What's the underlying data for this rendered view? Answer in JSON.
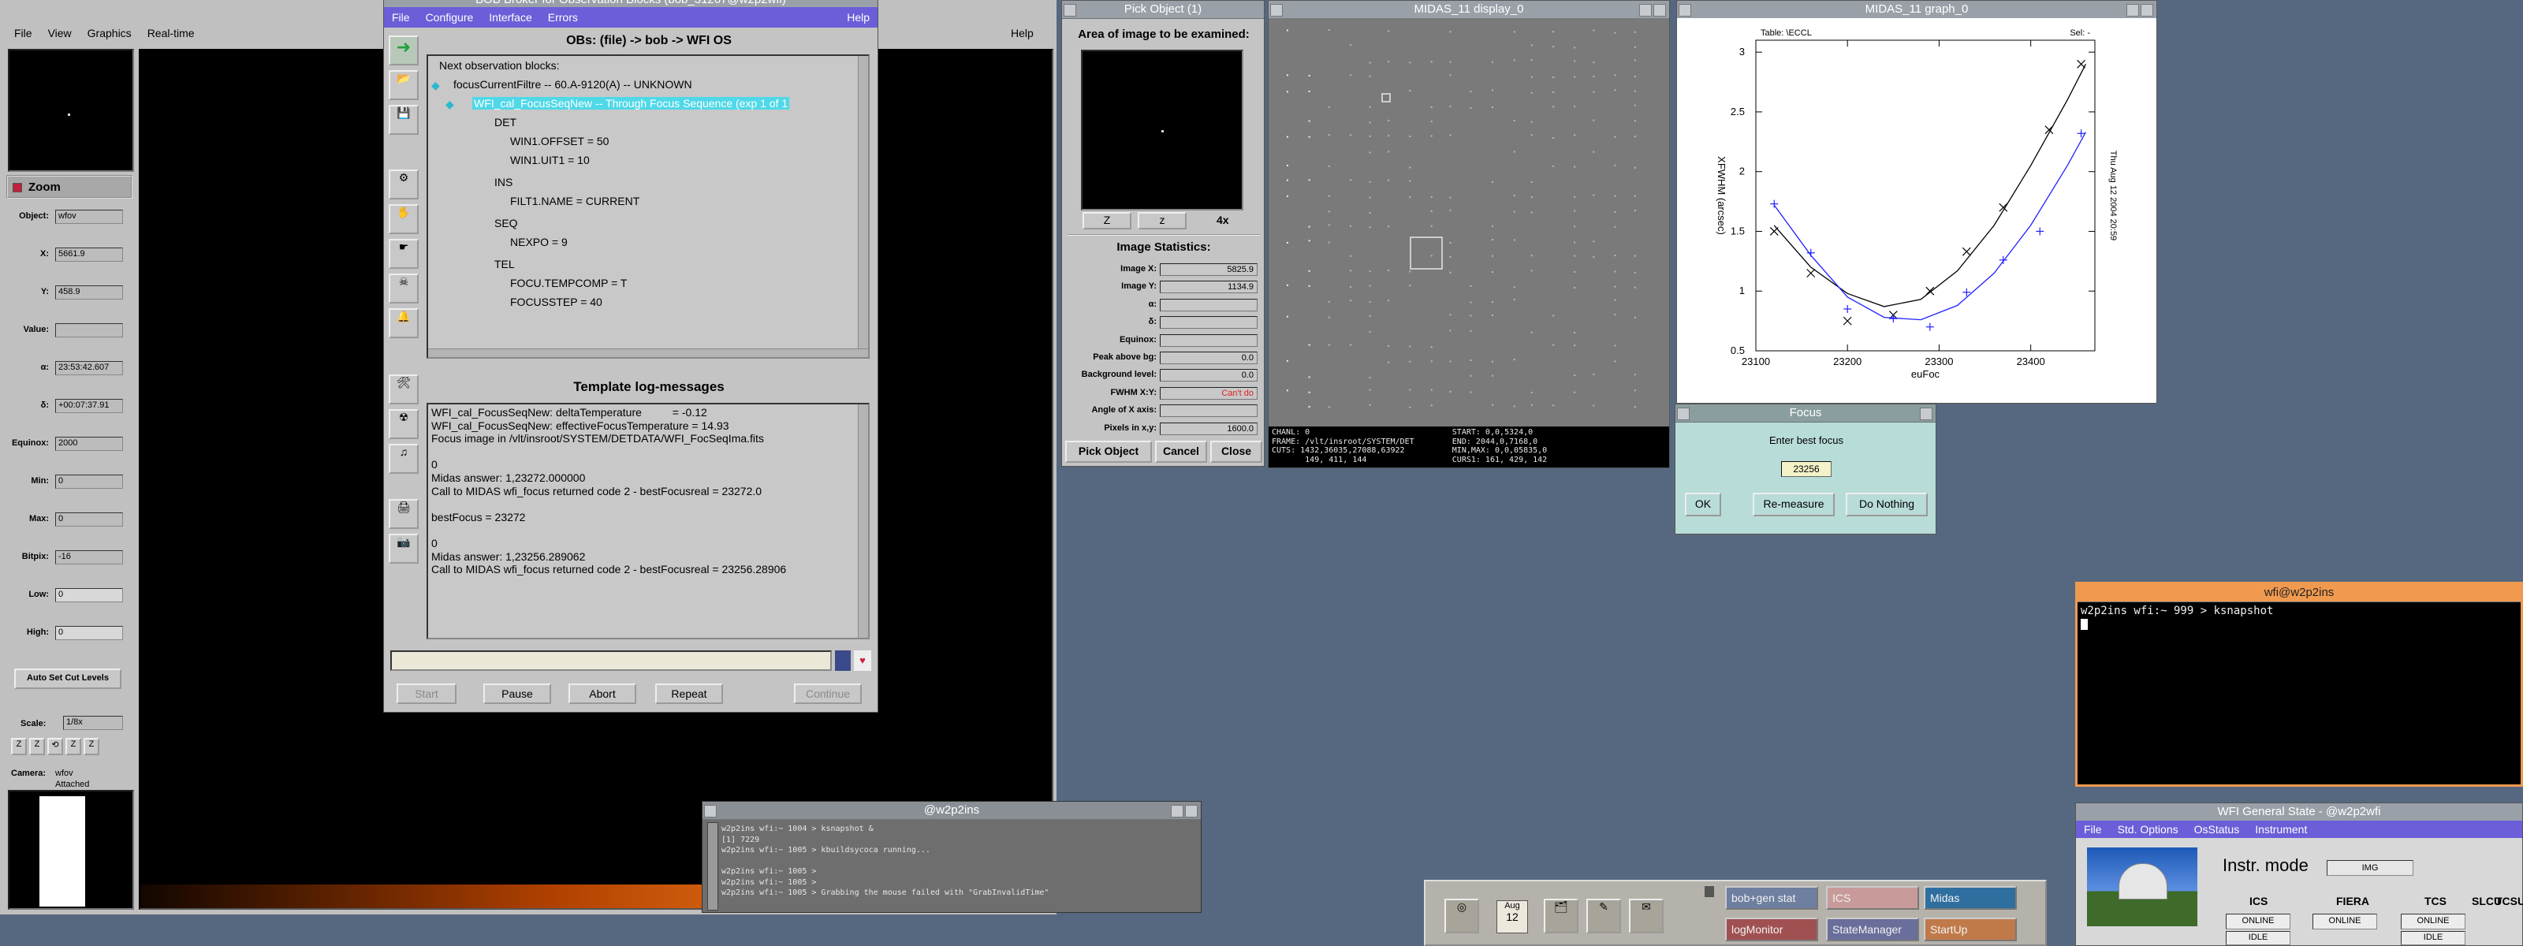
{
  "rtd": {
    "menu": [
      "File",
      "View",
      "Graphics",
      "Real-time"
    ],
    "zoom_label": "Zoom",
    "fields": [
      {
        "label": "Object:",
        "value": "wfov"
      },
      {
        "label": "X:",
        "value": "5661.9"
      },
      {
        "label": "Y:",
        "value": "458.9"
      },
      {
        "label": "Value:",
        "value": ""
      },
      {
        "label": "α:",
        "value": "23:53:42.607"
      },
      {
        "label": "δ:",
        "value": "+00:07:37.91"
      },
      {
        "label": "Equinox:",
        "value": "2000"
      },
      {
        "label": "Min:",
        "value": "0"
      },
      {
        "label": "Max:",
        "value": "0"
      },
      {
        "label": "Bitpix:",
        "value": "-16"
      },
      {
        "label": "Low:",
        "value": "0"
      },
      {
        "label": "High:",
        "value": "0"
      }
    ],
    "autocut_label": "Auto Set Cut Levels",
    "scale_label": "Scale:",
    "scale_value": "1/8x",
    "camera_label": "Camera:",
    "camera_value": "wfov",
    "camera_status": "Attached",
    "help": "Help"
  },
  "bob": {
    "title": "BOB Broker for Observation Blocks (bob_31267@w2p2wfi)",
    "menu": [
      "File",
      "Configure",
      "Interface",
      "Errors"
    ],
    "help": "Help",
    "ob_title": "OBs: (file) -> bob -> WFI OS",
    "tree": [
      {
        "text": "Next observation blocks:",
        "indent": 0,
        "selected": false
      },
      {
        "text": "focusCurrentFiltre --  60.A-9120(A) -- UNKNOWN",
        "indent": 1,
        "selected": false
      },
      {
        "text": "WFI_cal_FocusSeqNew -- Through Focus Sequence (exp 1 of 1",
        "indent": 2,
        "selected": true
      },
      {
        "text": "DET",
        "indent": 3,
        "selected": false
      },
      {
        "text": "WIN1.OFFSET = 50",
        "indent": 4,
        "selected": false
      },
      {
        "text": "WIN1.UIT1 = 10",
        "indent": 4,
        "selected": false
      },
      {
        "text": "INS",
        "indent": 3,
        "selected": false
      },
      {
        "text": "FILT1.NAME = CURRENT",
        "indent": 4,
        "selected": false
      },
      {
        "text": "SEQ",
        "indent": 3,
        "selected": false
      },
      {
        "text": "NEXPO = 9",
        "indent": 4,
        "selected": false
      },
      {
        "text": "TEL",
        "indent": 3,
        "selected": false
      },
      {
        "text": "FOCU.TEMPCOMP = T",
        "indent": 4,
        "selected": false
      },
      {
        "text": "FOCUSSTEP = 40",
        "indent": 4,
        "selected": false
      }
    ],
    "log_title": "Template log-messages",
    "log": [
      "WFI_cal_FocusSeqNew: deltaTemperature          = -0.12",
      "WFI_cal_FocusSeqNew: effectiveFocusTemperature = 14.93",
      "Focus image in /vlt/insroot/SYSTEM/DETDATA/WFI_FocSeqIma.fits",
      "",
      "0",
      "Midas answer: 1,23272.000000",
      "Call to MIDAS wfi_focus returned code 2 - bestFocusreal = 23272.0",
      "",
      "bestFocus = 23272",
      "",
      "0",
      "Midas answer: 1,23256.289062",
      "Call to MIDAS wfi_focus returned code 2 - bestFocusreal = 23256.28906"
    ],
    "buttons": [
      "Start",
      "Pause",
      "Abort",
      "Repeat",
      "Continue"
    ]
  },
  "pick": {
    "title": "Pick Object (1)",
    "area_label": "Area of image to be examined:",
    "zoom_buttons": [
      "Z",
      "z",
      "4x"
    ],
    "stats_title": "Image Statistics:",
    "rows": [
      {
        "label": "Image X:",
        "value": "5825.9"
      },
      {
        "label": "Image Y:",
        "value": "1134.9"
      },
      {
        "label": "α:",
        "value": ""
      },
      {
        "label": "δ:",
        "value": ""
      },
      {
        "label": "Equinox:",
        "value": ""
      },
      {
        "label": "Peak above bg:",
        "value": "0.0"
      },
      {
        "label": "Background level:",
        "value": "0.0"
      },
      {
        "label": "FWHM X:Y:",
        "value": "Can't do"
      },
      {
        "label": "Angle of X axis:",
        "value": ""
      },
      {
        "label": "Pixels in x,y:",
        "value": "1600.0"
      }
    ],
    "buttons": [
      "Pick Object",
      "Cancel",
      "Close"
    ]
  },
  "midas_display": {
    "title": "MIDAS_11 display_0",
    "info_lines": [
      "CHANL: 0                              START: 0,0,5324,0",
      "FRAME: /vlt/insroot/SYSTEM/DET        END: 2044,0,7168,0",
      "CUTS: 1432,36035,27088,63922          MIN,MAX: 0,0,05835,0",
      "       149, 411, 144                  CURS1: 161, 429, 142"
    ]
  },
  "graph": {
    "title": "MIDAS_11 graph_0",
    "corner_left": "Table: \\ECCL",
    "corner_right": "Sel: -",
    "side_text": "Thu Aug 12 2004 20:59",
    "chart_data": {
      "type": "scatter",
      "xlabel": "euFoc",
      "ylabel": "XFWHM (arcsec)",
      "xlim": [
        23100,
        23470
      ],
      "ylim": [
        0.5,
        3.1
      ],
      "xticks": [
        23100,
        23200,
        23300,
        23400
      ],
      "yticks": [
        0.5,
        1,
        1.5,
        2,
        2.5,
        3
      ],
      "series": [
        {
          "marker": "x",
          "color": "#000000",
          "x": [
            23120,
            23160,
            23200,
            23250,
            23290,
            23330,
            23370,
            23420,
            23455
          ],
          "y": [
            1.5,
            1.15,
            0.75,
            0.8,
            1.0,
            1.33,
            1.7,
            2.35,
            2.9
          ],
          "fit_x": [
            23120,
            23160,
            23200,
            23240,
            23280,
            23320,
            23360,
            23400,
            23440,
            23460
          ],
          "fit_y": [
            1.55,
            1.2,
            0.98,
            0.87,
            0.93,
            1.17,
            1.55,
            2.05,
            2.6,
            2.9
          ]
        },
        {
          "marker": "+",
          "color": "#2020ff",
          "x": [
            23120,
            23160,
            23200,
            23250,
            23290,
            23330,
            23370,
            23410,
            23455
          ],
          "y": [
            1.73,
            1.32,
            0.85,
            0.77,
            0.7,
            0.99,
            1.26,
            1.5,
            2.32
          ],
          "fit_x": [
            23120,
            23160,
            23200,
            23240,
            23280,
            23320,
            23360,
            23400,
            23440,
            23460
          ],
          "fit_y": [
            1.72,
            1.3,
            0.95,
            0.78,
            0.76,
            0.88,
            1.15,
            1.55,
            2.05,
            2.33
          ]
        }
      ]
    }
  },
  "focus": {
    "title": "Focus",
    "prompt": "Enter best focus",
    "value": "23256",
    "buttons": [
      "OK",
      "Re-measure",
      "Do Nothing"
    ]
  },
  "xterm1": {
    "title": "wfi@w2p2ins",
    "lines": [
      "w2p2ins wfi:~ 999 > ksnapshot"
    ]
  },
  "xterm2": {
    "title": "@w2p2ins",
    "lines": [
      "w2p2ins wfi:~ 1004 > ksnapshot &",
      "[1] 7229",
      "w2p2ins wfi:~ 1005 > kbuildsycoca running...",
      "",
      "w2p2ins wfi:~ 1005 >",
      "w2p2ins wfi:~ 1005 >",
      "w2p2ins wfi:~ 1005 > Grabbing the mouse failed with \"GrabInvalidTime\""
    ]
  },
  "panel": {
    "date_month": "Aug",
    "date_day": "12",
    "buttons": [
      {
        "label": "bob+gen stat",
        "bg": "#6f7f9f"
      },
      {
        "label": "ICS",
        "bg": "#c89a9a"
      },
      {
        "label": "Midas",
        "bg": "#2f6f9f"
      },
      {
        "label": "logMonitor",
        "bg": "#a05050"
      },
      {
        "label": "StateManager",
        "bg": "#6a6e9a"
      },
      {
        "label": "StartUp",
        "bg": "#c07a4a"
      }
    ]
  },
  "wfistate": {
    "title": "WFI General State - @w2p2wfi",
    "menu": [
      "File",
      "Std. Options",
      "OsStatus",
      "Instrument"
    ],
    "instr_label": "Instr. mode",
    "instr_value": "IMG",
    "cols": [
      {
        "name": "ICS",
        "state": "ONLINE",
        "sub": "IDLE"
      },
      {
        "name": "FIERA",
        "state": "ONLINE",
        "sub": ""
      },
      {
        "name": "TCS",
        "state": "ONLINE",
        "sub": "IDLE"
      },
      {
        "name": "SLCU",
        "state": "",
        "sub": ""
      },
      {
        "name": "TCSU",
        "state": "",
        "sub": ""
      }
    ]
  },
  "colors": {
    "desktop": "#56687f",
    "selection": "#4fd8e8",
    "menu_blue": "#6b5ed8",
    "window_grey": "#c4c4c4"
  }
}
